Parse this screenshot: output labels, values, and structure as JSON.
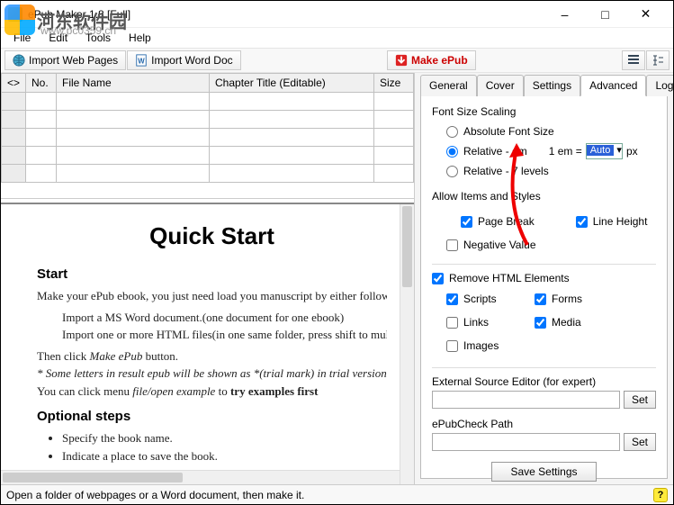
{
  "window": {
    "title": "ePub Maker 1.8 [Full]"
  },
  "watermark": {
    "text": "河东软件园",
    "url": "www.pc0359.cn"
  },
  "menu": {
    "file": "File",
    "edit": "Edit",
    "tools": "Tools",
    "help": "Help"
  },
  "toolbar": {
    "import_web": "Import Web Pages",
    "import_word": "Import Word Doc",
    "make_epub": "Make ePub"
  },
  "table": {
    "col_marker": "<>",
    "col_no": "No.",
    "col_filename": "File Name",
    "col_chapter": "Chapter Title (Editable)",
    "col_size": "Size"
  },
  "preview": {
    "h1": "Quick Start",
    "h2a": "Start",
    "p1": "Make your ePub ebook, you just need load you manuscript by either following way:",
    "li1": "Import a MS Word document.(one document for one ebook)",
    "li2": "Import one or more HTML files(in one same folder, press shift to multi-select).",
    "p2a": "Then click ",
    "p2em": "Make ePub",
    "p2b": " button.",
    "p3em": "* Some letters in result epub will be shown as *(trial mark) in trial version.",
    "p4a": "You can click menu ",
    "p4em": "file/open example",
    "p4b": " to ",
    "p4strong": "try examples first",
    "h2b": "Optional steps",
    "li3": "Specify the book name.",
    "li4": "Indicate a place to save the book."
  },
  "tabs": {
    "general": "General",
    "cover": "Cover",
    "settings": "Settings",
    "advanced": "Advanced",
    "log": "Log"
  },
  "advanced": {
    "font_scaling": "Font Size Scaling",
    "absolute": "Absolute Font Size",
    "relative_em": "Relative - em",
    "relative_7": "Relative - 7 levels",
    "em_label_a": "1 em =",
    "em_value": "Auto",
    "em_label_b": "px",
    "allow_items": "Allow Items and Styles",
    "page_break": "Page Break",
    "line_height": "Line Height",
    "negative": "Negative Value",
    "remove_html": "Remove HTML Elements",
    "scripts": "Scripts",
    "forms": "Forms",
    "links": "Links",
    "media": "Media",
    "images": "Images",
    "ext_editor": "External Source Editor (for expert)",
    "epubcheck": "ePubCheck Path",
    "set": "Set",
    "save": "Save Settings"
  },
  "status": {
    "text": "Open a folder of webpages or a Word document, then make it."
  }
}
